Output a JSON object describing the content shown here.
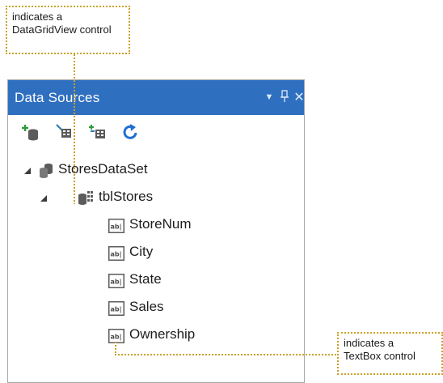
{
  "callouts": {
    "top": {
      "line1": "indicates a",
      "line2": "DataGridView control"
    },
    "bottom": {
      "line1": "indicates a",
      "line2": "TextBox control"
    }
  },
  "panel": {
    "title": "Data Sources",
    "header_buttons": [
      {
        "name": "dropdown-icon",
        "glyph": "▼"
      },
      {
        "name": "pin-icon",
        "glyph": "'"
      },
      {
        "name": "close-icon",
        "glyph": "✕"
      }
    ],
    "toolbar": [
      {
        "name": "add-new-data-source-button",
        "icon": "add-database-icon"
      },
      {
        "name": "edit-dataset-designer-button",
        "icon": "edit-dataset-icon"
      },
      {
        "name": "configure-dataset-wizard-button",
        "icon": "configure-dataset-icon"
      },
      {
        "name": "refresh-button",
        "icon": "refresh-icon"
      }
    ],
    "tree": {
      "dataset": {
        "label": "StoresDataSet",
        "icon": "dataset-icon",
        "expanded": true
      },
      "table": {
        "label": "tblStores",
        "icon": "datagridview-icon",
        "expanded": true
      },
      "fields": [
        {
          "label": "StoreNum",
          "icon": "textbox-icon"
        },
        {
          "label": "City",
          "icon": "textbox-icon"
        },
        {
          "label": "State",
          "icon": "textbox-icon"
        },
        {
          "label": "Sales",
          "icon": "textbox-icon"
        },
        {
          "label": "Ownership",
          "icon": "textbox-icon"
        }
      ]
    }
  },
  "colors": {
    "header_bg": "#2f6fc0",
    "callout_border": "#c9a227",
    "icon_gray": "#5b5b5b",
    "add_green": "#2e9a3a",
    "refresh_blue": "#1f6fd1"
  }
}
